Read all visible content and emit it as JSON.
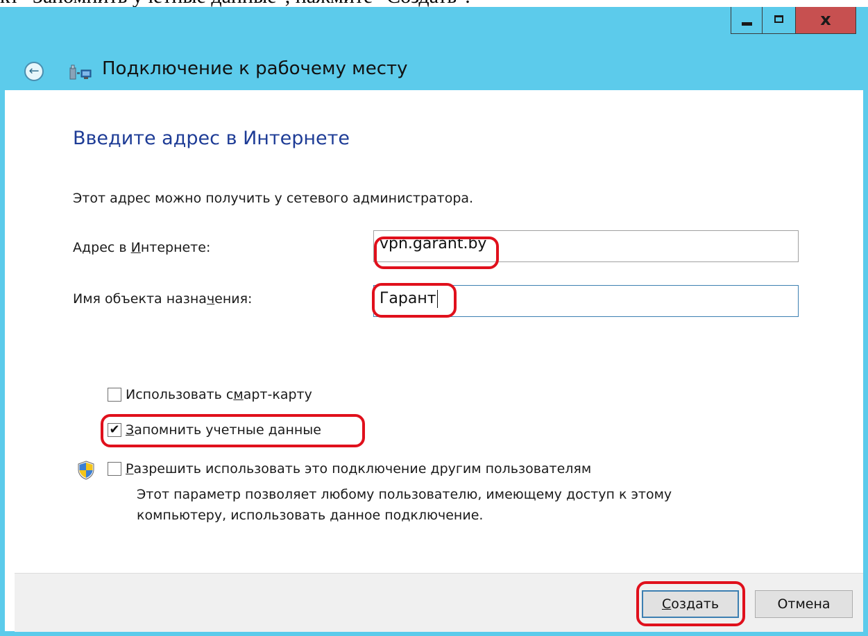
{
  "document": {
    "caption": "кт \"Запомнить учетные данные\", нажмите \"Создать\"."
  },
  "window": {
    "title": "Подключение к рабочему месту",
    "controls": {
      "minimize_icon": "minimize-icon",
      "maximize_icon": "maximize-icon",
      "close_glyph": "x"
    }
  },
  "page": {
    "heading": "Введите адрес в Интернете",
    "intro": "Этот адрес можно получить у сетевого администратора.",
    "address": {
      "label_pre": "Адрес в ",
      "label_accel": "И",
      "label_post": "нтернете:",
      "value": "vpn.garant.by"
    },
    "destination": {
      "label_pre": "Имя объекта назна",
      "label_accel": "ч",
      "label_post": "ения:",
      "value": "Гарант"
    },
    "options": {
      "smartcard": {
        "label_pre": "Использовать с",
        "label_accel": "м",
        "label_post": "арт-карту",
        "checked": false
      },
      "remember": {
        "label_pre": "",
        "label_accel": "З",
        "label_post": "апомнить учетные данные",
        "checked": true,
        "check_glyph": "✔"
      },
      "allow_others": {
        "label_pre": "",
        "label_accel": "Р",
        "label_post": "азрешить использовать это подключение другим пользователям",
        "checked": false,
        "icon": "uac-shield-icon"
      }
    },
    "note": "Этот параметр позволяет любому пользователю, имеющему доступ к этому компьютеру, использовать данное подключение."
  },
  "footer": {
    "create": {
      "accel": "С",
      "label_post": "оздать"
    },
    "cancel": {
      "label": "Отмена"
    }
  },
  "colors": {
    "titlebar": "#5ccbeb",
    "heading": "#1e3c96",
    "highlight": "#e0101c",
    "close_button": "#c75050"
  }
}
